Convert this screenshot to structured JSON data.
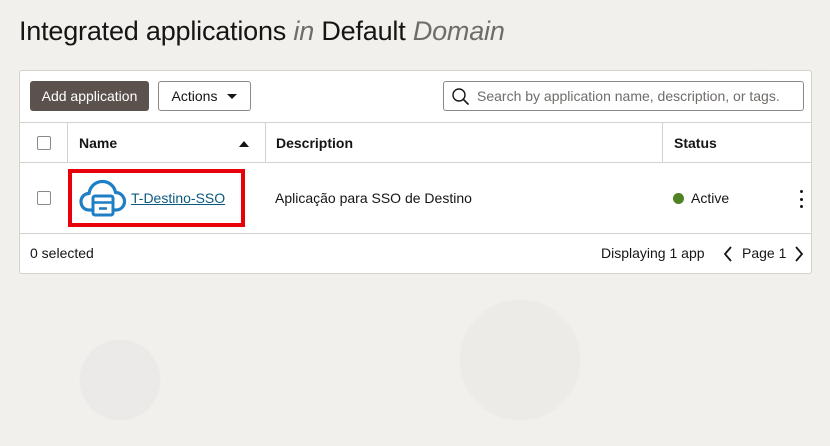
{
  "header": {
    "title_part1": "Integrated applications",
    "title_in": "in",
    "title_part2": "Default",
    "title_domain": "Domain"
  },
  "toolbar": {
    "add_label": "Add application",
    "actions_label": "Actions",
    "search_placeholder": "Search by application name, description, or tags."
  },
  "table": {
    "columns": {
      "name": "Name",
      "description": "Description",
      "status": "Status"
    },
    "sort": "name-ascending",
    "rows": [
      {
        "name": "T-Destino-SSO",
        "description": "Aplicação para SSO de Destino",
        "status": "Active",
        "status_color": "#508223",
        "icon": "cloud-app-icon"
      }
    ]
  },
  "footer": {
    "selected": "0 selected",
    "displaying": "Displaying 1 app",
    "page": "Page 1"
  },
  "colors": {
    "primary_button": "#5b524e",
    "link": "#0b5a80",
    "highlight_box": "#e8000b",
    "app_icon": "#1f7fc4"
  }
}
